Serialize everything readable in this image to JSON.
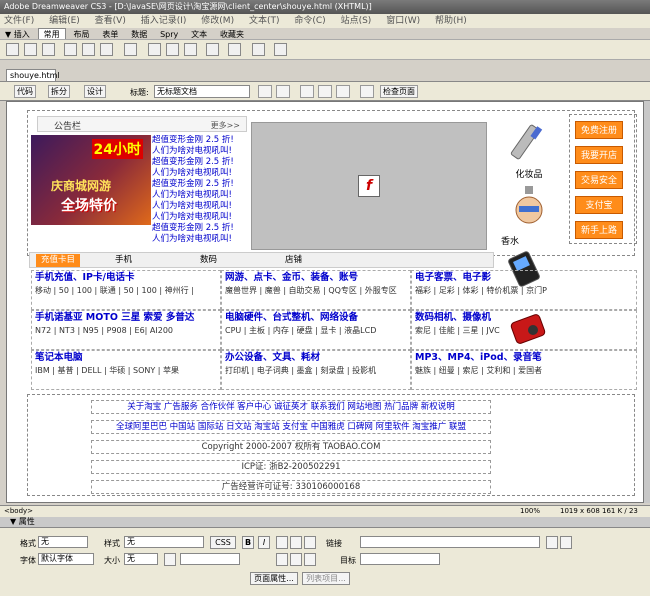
{
  "window": {
    "title": "Adobe Dreamweaver CS3 - [D:\\JavaSE\\网页设计\\淘宝源网\\client_center\\shouye.html (XHTML)]"
  },
  "menu": [
    "文件(F)",
    "编辑(E)",
    "查看(V)",
    "插入记录(I)",
    "修改(M)",
    "文本(T)",
    "命令(C)",
    "站点(S)",
    "窗口(W)",
    "帮助(H)"
  ],
  "insert_tabs": [
    "▼ 插入",
    "常用",
    "布局",
    "表单",
    "数据",
    "Spry",
    "文本",
    "收藏夹"
  ],
  "doc_tab": "shouye.html",
  "doc_toolbar": {
    "code": "代码",
    "split": "拆分",
    "design": "设计",
    "title_label": "标题:",
    "title_value": "无标题文档",
    "check_page": "检查页面"
  },
  "page": {
    "notice": {
      "title": "公告栏",
      "more": "更多>>"
    },
    "promo": {
      "badge": "24小时",
      "line1": "庆商城网游",
      "line2": "全场特价"
    },
    "notice_items": [
      "超值变形金刚 2.5 折!",
      "人们为啥对电视吼叫!",
      "超值变形金刚 2.5 折!",
      "人们为啥对电视吼叫!",
      "超值变形金刚 2.5 折!",
      "人们为啥对电视吼叫!",
      "人们为啥对电视吼叫!",
      "人们为啥对电视吼叫!",
      "超值变形金刚 2.5 折!",
      "人们为啥对电视吼叫!"
    ],
    "side_buttons": [
      "免费注册",
      "我要开店",
      "交易安全",
      "支付宝",
      "新手上路"
    ],
    "products": [
      {
        "caption": "化妆品"
      },
      {
        "caption": "香水"
      }
    ],
    "tabs": [
      "充值卡目",
      "手机",
      "数码",
      "店铺"
    ],
    "categories": [
      {
        "title": "手机充值、IP卡/电话卡",
        "sub": "移动 | 50 | 100 | 联通 | 50 | 100 | 神州行 |"
      },
      {
        "title": "网游、点卡、金币、装备、账号",
        "sub": "魔兽世界 | 魔兽 | 自助交易 | QQ专区 | 外服专区"
      },
      {
        "title": "电子客票、电子影",
        "sub": "福彩 | 足彩 | 体彩 | 特价机票 | 京门P"
      },
      {
        "title": "手机诺基亚 MOTO 三星 索爱 多普达",
        "sub": "N72 | NT3 | N95 | P908 | E6| AI200"
      },
      {
        "title": "电脑硬件、台式整机、网络设备",
        "sub": "CPU | 主板 | 内存 | 硬盘 | 显卡 | 液晶LCD"
      },
      {
        "title": "数码相机、摄像机",
        "sub": "索尼 | 佳能 | 三星 | JVC"
      },
      {
        "title": "笔记本电脑",
        "sub": "IBM | 基普 | DELL | 华硕 | SONY | 苹果"
      },
      {
        "title": "办公设备、文具、耗材",
        "sub": "打印机 | 电子词典 | 墨盒 | 刻录盘 | 投影机"
      },
      {
        "title": "MP3、MP4、iPod、录音笔",
        "sub": "魅族 | 纽曼 | 索尼 | 艾利和 | 爱国者"
      }
    ],
    "footer": [
      "关于淘宝 广告服务 合作伙伴 客户中心 诚征英才 联系我们 网站地图 热门品牌 新权说明",
      "全球阿里巴巴 中国站 国际站 日文站 淘宝站 支付宝 中国雅虎 口碑网 阿里软件 淘宝推广 联盟",
      "Copyright 2000-2007 权所有 TAOBAO.COM",
      "ICP证: 浙B2-200502291",
      "广告经营许可证号: 330106000168"
    ]
  },
  "status": {
    "tag": "<body>",
    "zoom": "100%",
    "size": "1019 x 608 161 K / 23"
  },
  "properties": {
    "panel_title": "▼ 属性",
    "format_label": "格式",
    "format_value": "无",
    "style_label": "样式",
    "style_value": "无",
    "css_button": "CSS",
    "bold": "B",
    "italic": "I",
    "link_label": "链接",
    "font_label": "字体",
    "font_value": "默认字体",
    "size_label": "大小",
    "size_value": "无",
    "target_label": "目标",
    "page_props": "页面属性...",
    "list_item": "列表项目..."
  }
}
